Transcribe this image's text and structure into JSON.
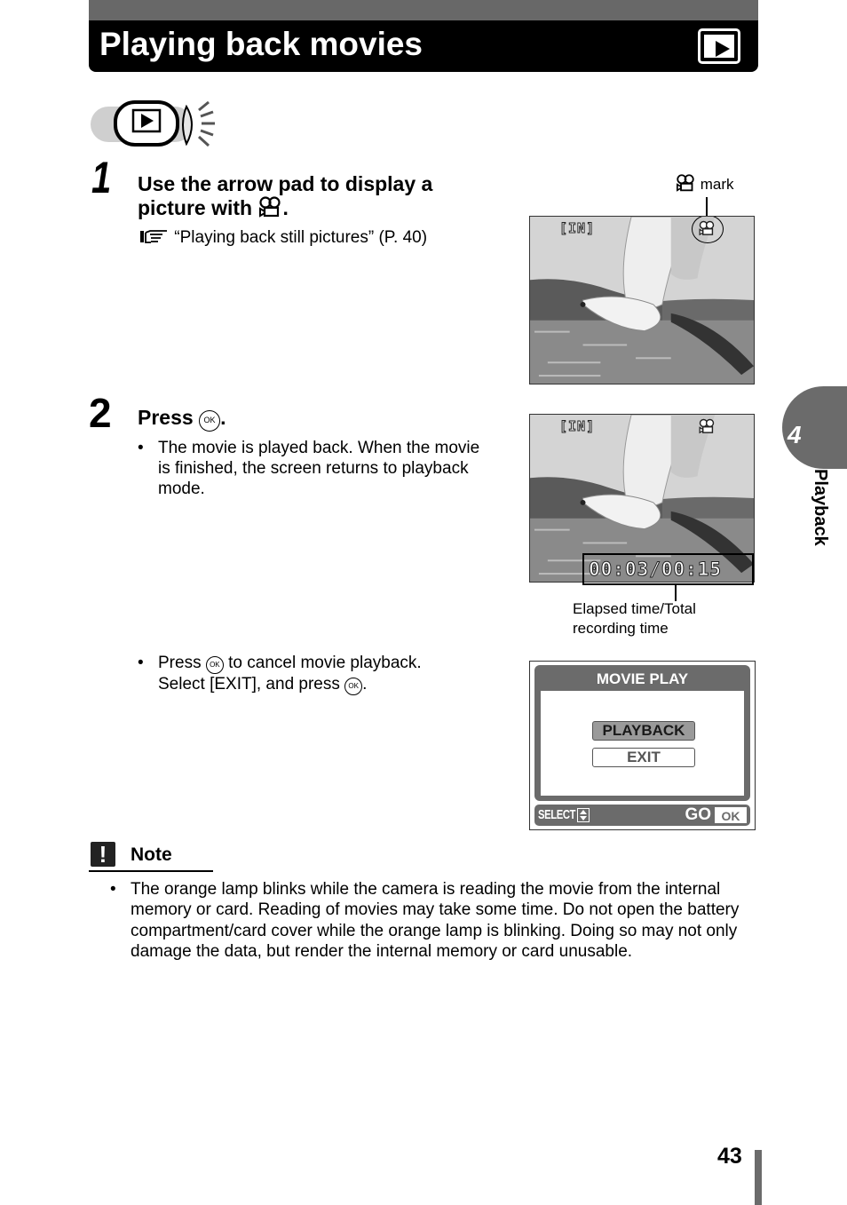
{
  "header": {
    "title": "Playing back movies",
    "mode_icon": "playback-mode-icon"
  },
  "mode_illustration": {
    "icon": "playback-button-icon",
    "description": "Playback button pressed, lamp blinking"
  },
  "steps": [
    {
      "number": "1",
      "heading_part1": "Use the arrow pad to display a",
      "heading_part2": "picture with",
      "heading_icon": "movie-icon",
      "heading_end": ".",
      "reference_icon": "pointing-hand-icon",
      "reference": "“Playing back still pictures” (P. 40)"
    },
    {
      "number": "2",
      "heading_part1": "Press",
      "heading_icon": "ok-button-icon",
      "heading_end": ".",
      "bullets": [
        "The movie is played back. When the movie is finished, the screen returns to playback mode."
      ],
      "bullet2_part1": "Press",
      "bullet2_part2": "to cancel movie playback.",
      "bullet2_part3": "Select [EXIT], and press",
      "bullet2_end": "."
    }
  ],
  "ok_label": "OK",
  "screens": {
    "screen1": {
      "memory_indicator": "[IN]",
      "callout_label": "mark",
      "callout_icon": "movie-icon"
    },
    "screen2": {
      "memory_indicator": "[IN]",
      "time_display": "00:03/00:15",
      "callout_label_line1": "Elapsed time/Total",
      "callout_label_line2": "recording time"
    },
    "menu": {
      "title": "MOVIE PLAY",
      "options": [
        "PLAYBACK",
        "EXIT"
      ],
      "selected": "PLAYBACK",
      "footer_select": "SELECT",
      "footer_go": "GO",
      "footer_ok": "OK"
    }
  },
  "note": {
    "icon": "exclamation-icon",
    "title": "Note",
    "text": "The orange lamp blinks while the camera is reading the movie from the internal memory or card. Reading of movies may take some time. Do not open the battery compartment/card cover while the orange lamp is blinking. Doing so may not only damage the data, but render the internal memory or card unusable."
  },
  "chapter": {
    "number": "4",
    "label": "Playback"
  },
  "page_number": "43",
  "colors": {
    "header_bg": "#000000",
    "band_gray": "#686868",
    "tab_gray": "#6b6b6b"
  }
}
